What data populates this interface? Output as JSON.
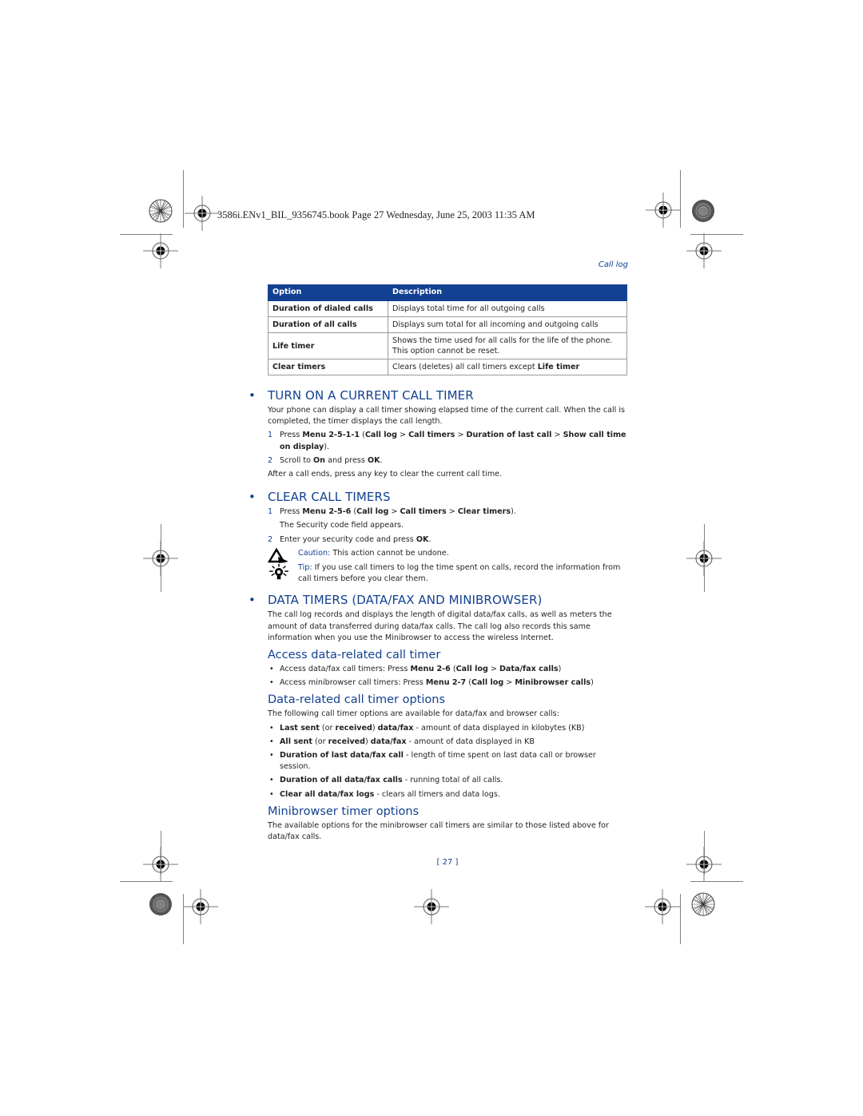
{
  "print_header": "3586i.ENv1_BIL_9356745.book  Page 27  Wednesday, June 25, 2003  11:35 AM",
  "running_head": "Call log",
  "colors": {
    "accent": "#124191",
    "text": "#231f20"
  },
  "table": {
    "headers": [
      "Option",
      "Description"
    ],
    "rows": [
      {
        "option": "Duration of dialed calls",
        "description": "Displays total time for all outgoing calls"
      },
      {
        "option": "Duration of all calls",
        "description": "Displays sum total for all incoming and outgoing calls"
      },
      {
        "option": "Life timer",
        "description": "Shows the time used for all calls for the life of the phone. This option cannot be reset."
      },
      {
        "option": "Clear timers",
        "description_prefix": "Clears (deletes) all call timers except ",
        "description_bold": "Life timer"
      }
    ]
  },
  "sections": {
    "turn_on": {
      "title": "TURN ON A CURRENT CALL TIMER",
      "intro": "Your phone can display a call timer showing elapsed time of the current call. When the call is completed, the timer displays the call length.",
      "step1": {
        "num": "1",
        "pre": "Press ",
        "menu": "Menu 2-5-1-1",
        "open": " (",
        "p1": "Call log",
        "sep1": " > ",
        "p2": "Call timers",
        "sep2": " > ",
        "p3": "Duration of last call",
        "sep3": " > ",
        "p4": "Show call time on display",
        "close": ")."
      },
      "step2": {
        "num": "2",
        "pre": "Scroll to ",
        "b1": "On",
        "mid": " and press ",
        "b2": "OK",
        "end": "."
      },
      "after": "After a call ends, press any key to clear the current call time."
    },
    "clear": {
      "title": "CLEAR CALL TIMERS",
      "step1": {
        "num": "1",
        "pre": "Press ",
        "menu": "Menu 2-5-6",
        "open": " (",
        "p1": "Call log",
        "sep1": " > ",
        "p2": "Call timers",
        "sep2": " > ",
        "p3": "Clear timers",
        "close": ")."
      },
      "step1_sub": "The Security code field appears.",
      "step2": {
        "num": "2",
        "pre": "Enter your security code and press ",
        "b1": "OK",
        "end": "."
      },
      "caution": {
        "label": "Caution:",
        "text": " This action cannot be undone.",
        "icon": "caution-icon"
      },
      "tip": {
        "label": "Tip:",
        "text": " If you use call timers to log the time spent on calls, record the information from call timers before you clear them.",
        "icon": "tip-lightbulb-icon"
      }
    },
    "data_timers": {
      "title": "DATA TIMERS (DATA/FAX AND MINIBROWSER)",
      "intro": "The call log records and displays the length of digital data/fax calls, as well as meters the amount of data transferred during data/fax calls. The call log also records this same information when you use the Minibrowser to access the wireless Internet.",
      "access": {
        "title": "Access data-related call timer",
        "items": [
          {
            "pre": "Access data/fax call timers: Press ",
            "menu": "Menu 2-6",
            "open": " (",
            "p1": "Call log",
            "sep": " > ",
            "p2": "Data/fax calls",
            "close": ")"
          },
          {
            "pre": "Access minibrowser call timers: Press ",
            "menu": "Menu 2-7",
            "open": " (",
            "p1": "Call log",
            "sep": " > ",
            "p2": "Minibrowser calls",
            "close": ")"
          }
        ]
      },
      "options": {
        "title": "Data-related call timer options",
        "intro": "The following call timer options are available for data/fax and browser calls:",
        "items": [
          {
            "b1": "Last sent",
            "m1": " (or ",
            "b2": "received",
            "m2": ") ",
            "b3": "data/fax",
            "rest": " - amount of data displayed in kilobytes (KB)"
          },
          {
            "b1": "All sent",
            "m1": " (or ",
            "b2": "received",
            "m2": ") ",
            "b3": "data/fax",
            "rest": " - amount of data displayed in KB"
          },
          {
            "b1": "Duration of last data/fax call",
            "rest": " - length of time spent on last data call or browser session."
          },
          {
            "b1": "Duration of all data/fax calls",
            "rest": " - running total of all calls."
          },
          {
            "b1": "Clear all data/fax logs",
            "rest": " - clears all timers and data logs."
          }
        ]
      },
      "minibrowser": {
        "title": "Minibrowser timer options",
        "text": "The available options for the minibrowser call timers are similar to those listed above for data/fax calls."
      }
    }
  },
  "page_number": "[ 27 ]",
  "bullet_glyph": "•"
}
